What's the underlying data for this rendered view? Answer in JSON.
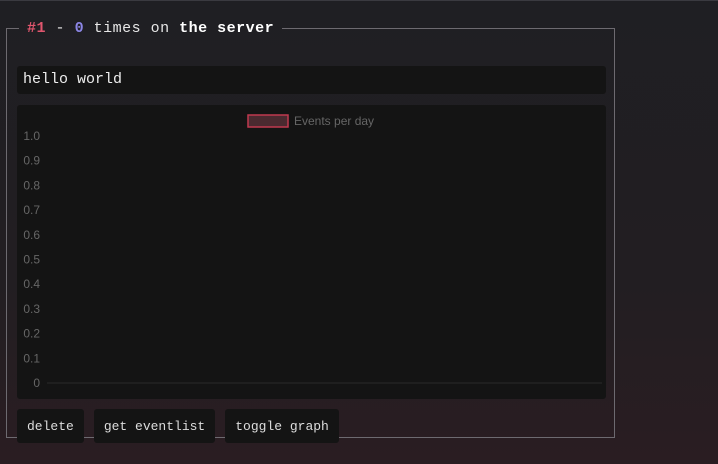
{
  "event": {
    "id_label": "#1",
    "separator": "-",
    "count": "0",
    "times_on_label": "times on",
    "server_label": "the server",
    "name": "hello world"
  },
  "chart_data": {
    "type": "line",
    "title": "",
    "xlabel": "",
    "ylabel": "",
    "legend": [
      "Events per day"
    ],
    "legend_position": "top-center",
    "series": [
      {
        "name": "Events per day",
        "values": [],
        "color": "#c0394f"
      }
    ],
    "yticks": [
      "1.0",
      "0.9",
      "0.8",
      "0.7",
      "0.6",
      "0.5",
      "0.4",
      "0.3",
      "0.2",
      "0.1",
      "0"
    ],
    "ylim": [
      0,
      1.0
    ],
    "grid": false
  },
  "buttons": {
    "delete": "delete",
    "get_eventlist": "get eventlist",
    "toggle_graph": "toggle graph"
  },
  "colors": {
    "accent_red": "#e0566e",
    "accent_purple": "#8c86e6",
    "panel_bg": "#141414"
  }
}
